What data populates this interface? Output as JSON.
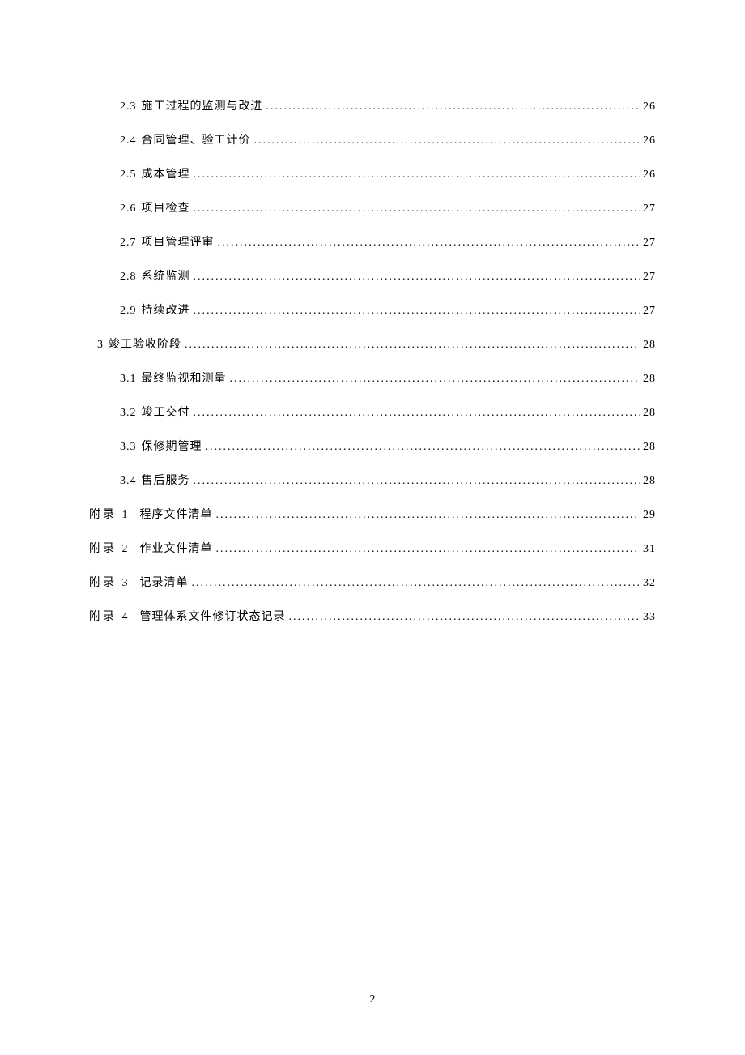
{
  "toc": [
    {
      "level": 2,
      "num": "2.3",
      "title": "施工过程的监测与改进",
      "page": "26"
    },
    {
      "level": 2,
      "num": "2.4",
      "title": "合同管理、验工计价",
      "page": "26"
    },
    {
      "level": 2,
      "num": "2.5",
      "title": "成本管理",
      "page": "26"
    },
    {
      "level": 2,
      "num": "2.6",
      "title": "项目检查",
      "page": "27"
    },
    {
      "level": 2,
      "num": "2.7",
      "title": "项目管理评审",
      "page": "27"
    },
    {
      "level": 2,
      "num": "2.8",
      "title": "系统监测",
      "page": "27"
    },
    {
      "level": 2,
      "num": "2.9",
      "title": "持续改进",
      "page": "27"
    },
    {
      "level": 1,
      "num": "3",
      "title": "竣工验收阶段",
      "page": "28"
    },
    {
      "level": 2,
      "num": "3.1",
      "title": "最终监视和测量",
      "page": "28"
    },
    {
      "level": 2,
      "num": "3.2",
      "title": "竣工交付",
      "page": "28"
    },
    {
      "level": 2,
      "num": "3.3",
      "title": "保修期管理",
      "page": "28"
    },
    {
      "level": 2,
      "num": "3.4",
      "title": "售后服务",
      "page": "28"
    }
  ],
  "appendix": [
    {
      "label": "附录 1",
      "title": "程序文件清单",
      "page": "29"
    },
    {
      "label": "附录 2",
      "title": "作业文件清单",
      "page": "31"
    },
    {
      "label": "附录 3",
      "title": "记录清单",
      "page": "32"
    },
    {
      "label": "附录 4",
      "title": "管理体系文件修订状态记录",
      "page": "33"
    }
  ],
  "pageNumber": "2",
  "dots": "................................................................................................................................"
}
